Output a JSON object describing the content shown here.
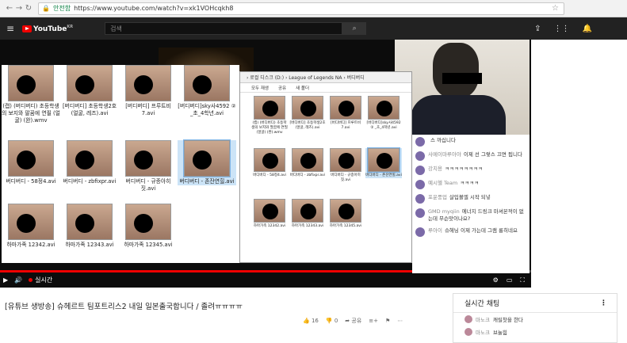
{
  "browser": {
    "secure_label": "안전함",
    "url": "https://www.youtube.com/watch?v=xk1VOHcqkh8"
  },
  "youtube": {
    "logo": "YouTube",
    "region": "KR",
    "search_placeholder": "검색"
  },
  "player": {
    "live_label": "실시간",
    "explorer_left_files": [
      {
        "name": "(캡) (버디버디) 초등학생의 보지와 팔꿈에 연필 (얼굴) (완).wmv"
      },
      {
        "name": "[버디버디] 초등학생2호(얼굴, 레즈).avi"
      },
      {
        "name": "[버디버디] 프루트비 7.avi"
      },
      {
        "name": "[버디버디]sky사4592 ② _초_4학년.avi"
      },
      {
        "name": "버디버디 - 58정4.avi"
      },
      {
        "name": "버디버디 - zbfixpr.avi"
      },
      {
        "name": "버디버디 - 규종아히짓.avi"
      },
      {
        "name": "버디버디 - 존잔연힐.avi"
      },
      {
        "name": "하마가족 12342.avi"
      },
      {
        "name": "하마가족 12343.avi"
      },
      {
        "name": "하마가족 12345.avi"
      }
    ],
    "explorer_right": {
      "breadcrumb": "› 로컬 디스크 (D:) › League of Legends NA › 버디버디",
      "toolbar": [
        "모두 재생",
        "공유",
        "새 폴더"
      ],
      "files": [
        {
          "name": "(캡) (버디버디) 초등학생의 보지와 팔꿈에 연필 (얼굴) (완).wmv"
        },
        {
          "name": "[버디버디] 초등학생2호(얼굴, 레즈).avi"
        },
        {
          "name": "[버디버디] 프루트비 7.avi"
        },
        {
          "name": "[버디버디]sky사4592 ② _초_4학년.avi"
        },
        {
          "name": "버디버디 - 58정4.avi"
        },
        {
          "name": "버디버디 - zbfixpr.avi"
        },
        {
          "name": "버디버디 - 규종아히짓.avi"
        },
        {
          "name": "버디버디 - 존잔연힐.avi"
        },
        {
          "name": "하마가족 12342.avi"
        },
        {
          "name": "하마가족 12343.avi"
        },
        {
          "name": "하마가족 12345.avi"
        }
      ]
    },
    "overlay_chat": [
      {
        "name": "",
        "text": "스 까십니다"
      },
      {
        "name": "사메이마루아야",
        "text": "이제 선 그렇스 끄면 됩니다"
      },
      {
        "name": "강치용",
        "text": "ㅋㅋㅋㅋㅋㅋㅋㅋ"
      },
      {
        "name": "예시헬 Team",
        "text": "ㅋㅋㅋㅋ"
      },
      {
        "name": "포운풍업",
        "text": "살입볼엘 시작 되넣"
      },
      {
        "name": "GMD myqiin",
        "text": "에너지 드링크 마셔본적이 없는데 무슨맛이나요?"
      },
      {
        "name": "루아이",
        "text": "슈헤닝 이제 가는데 그램 롱히네요"
      }
    ]
  },
  "video": {
    "title": "[유튜브 생방송] 슈헤르트 팀포트리스2 내일 일본출국합니다 / 졸려ㅠㅠㅠㅠ",
    "likes": "16",
    "dislikes": "0",
    "share_label": "공유"
  },
  "live_chat": {
    "header": "실시간 채팅",
    "messages": [
      {
        "name": "마노크",
        "text": "캐릴찻을 한다"
      },
      {
        "name": "마노크",
        "text": "브뉼힘"
      }
    ]
  }
}
